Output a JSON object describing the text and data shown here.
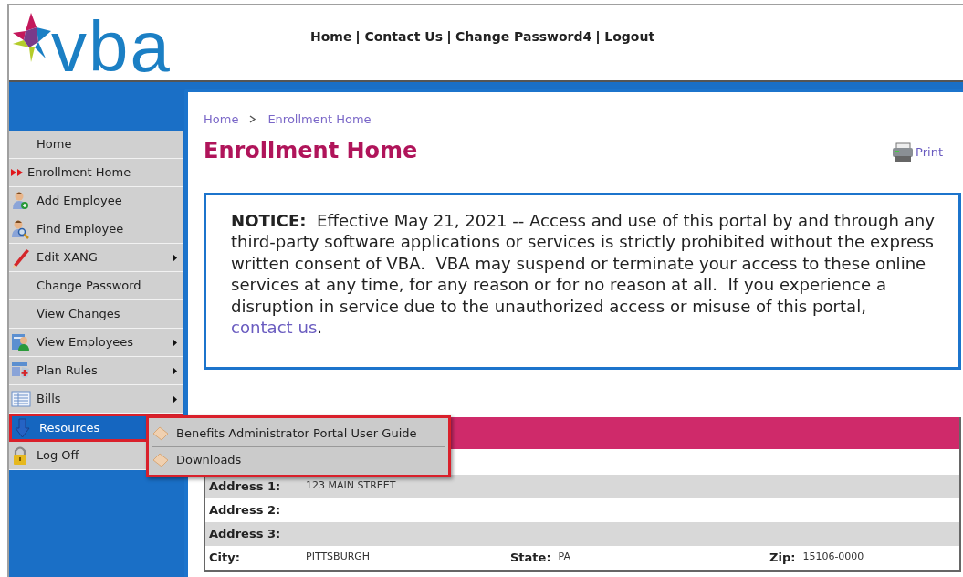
{
  "logo": {
    "text": "vba"
  },
  "header_links": [
    "Home",
    "Contact Us",
    "Change Password4",
    "Logout"
  ],
  "sidebar": {
    "items": [
      {
        "label": "Home",
        "current": false,
        "selected": false,
        "has_submenu": false
      },
      {
        "label": "Enrollment Home",
        "current": true,
        "selected": false,
        "has_submenu": false
      },
      {
        "label": "Add Employee",
        "current": false,
        "selected": false,
        "has_submenu": false
      },
      {
        "label": "Find Employee",
        "current": false,
        "selected": false,
        "has_submenu": false
      },
      {
        "label": "Edit XANG",
        "current": false,
        "selected": false,
        "has_submenu": true
      },
      {
        "label": "Change Password",
        "current": false,
        "selected": false,
        "has_submenu": false
      },
      {
        "label": "View Changes",
        "current": false,
        "selected": false,
        "has_submenu": false
      },
      {
        "label": "View Employees",
        "current": false,
        "selected": false,
        "has_submenu": true
      },
      {
        "label": "Plan Rules",
        "current": false,
        "selected": false,
        "has_submenu": true
      },
      {
        "label": "Bills",
        "current": false,
        "selected": false,
        "has_submenu": true
      },
      {
        "label": "Resources",
        "current": false,
        "selected": true,
        "has_submenu": false
      },
      {
        "label": "Log Off",
        "current": false,
        "selected": false,
        "has_submenu": false
      }
    ]
  },
  "submenu": {
    "items": [
      "Benefits Administrator Portal User Guide",
      "Downloads"
    ]
  },
  "breadcrumb": [
    "Home",
    "Enrollment Home"
  ],
  "page_title": "Enrollment Home",
  "print_label": "Print",
  "notice": {
    "text": "**NOTICE:**  Effective May 21, 2021 -- Access and use of this portal by and through any third-party software applications or services is strictly prohibited without the express written consent of VBA.  VBA may suspend or terminate your access to these online services at any time, for any reason or for no reason at all.  If you experience a disruption in service due to the unauthorized access or misuse of this portal, ",
    "link": "contact us",
    "after": "."
  },
  "details": {
    "rows": [
      [
        {
          "label": "Address 1:",
          "value": "123 MAIN STREET"
        }
      ],
      [
        {
          "label": "Address 2:"
        }
      ],
      [
        {
          "label": "Address 3:"
        }
      ],
      [
        {
          "label": "City:",
          "value": "PITTSBURGH"
        },
        {
          "label": "State:",
          "value": "PA"
        },
        {
          "label": "Zip:",
          "value": "15106-0000"
        }
      ]
    ]
  }
}
